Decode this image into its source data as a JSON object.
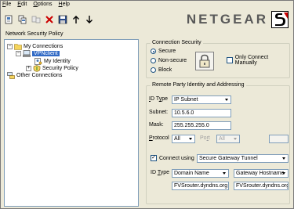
{
  "menubar": {
    "items": [
      {
        "underline": "F",
        "rest": "ile"
      },
      {
        "underline": "E",
        "rest": "dit"
      },
      {
        "underline": "O",
        "rest": "ptions"
      },
      {
        "underline": "H",
        "rest": "elp"
      }
    ]
  },
  "toolbar": {
    "buttons": [
      "new-connection-icon",
      "copy-icon",
      "disconnect-icon",
      "delete-icon",
      "save-icon",
      "move-up-icon",
      "move-down-icon"
    ]
  },
  "logo": {
    "text": "NETGEAR"
  },
  "left_panel": {
    "title": "Network Security Policy",
    "tree": {
      "my_connections": "My Connections",
      "vpn_client": "VPNclient",
      "my_identity": "My Identity",
      "security_policy": "Security Policy",
      "other_connections": "Other Connections"
    }
  },
  "connection_security": {
    "legend": "Connection Security",
    "options": [
      "Secure",
      "Non-secure",
      "Block"
    ],
    "selected": "Secure",
    "only_connect_manually": "Only Connect Manually"
  },
  "remote_party": {
    "legend": "Remote Party Identity and Addressing",
    "id_type_label": "ID Type",
    "id_type_value": "IP Subnet",
    "subnet_label": "Subnet:",
    "subnet_value": "10.5.6.0",
    "mask_label": "Mask:",
    "mask_value": "255.255.255.0",
    "protocol_label": "Protocol",
    "protocol_value": "All",
    "port_label": "Port",
    "port_value": "All",
    "port_value2": "",
    "connect_using_label": "Connect using",
    "connect_using_value": "Secure Gateway Tunnel",
    "id_type2_label": "ID Type",
    "gateway_id_type_value": "Domain Name",
    "gateway_addr_type_value": "Gateway Hostname",
    "gateway_domain": "FVSrouter.dyndns.org",
    "gateway_hostname": "FVSrouter.dyndns.org"
  },
  "colors": {
    "selection": "#316ac5",
    "window_bg": "#ece9d8",
    "field_border": "#7f9db9"
  }
}
